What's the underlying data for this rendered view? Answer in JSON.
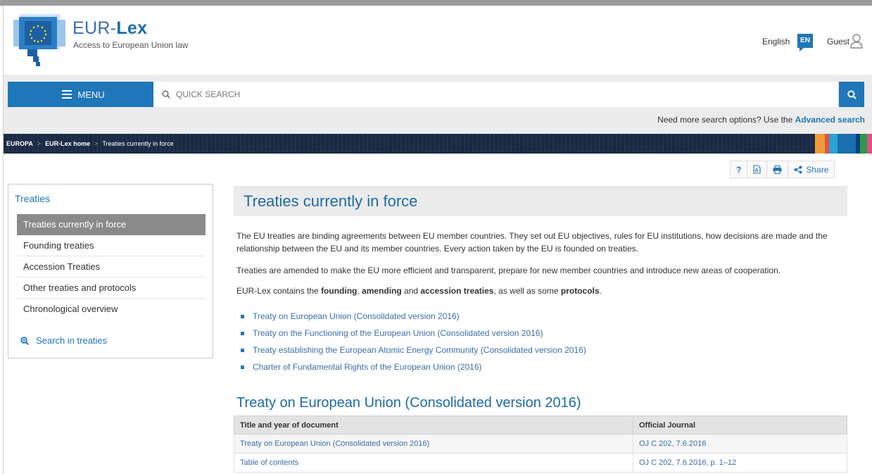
{
  "header": {
    "brand_prefix": "EUR-",
    "brand_bold": "Lex",
    "subtitle": "Access to European Union law",
    "language": "English",
    "language_code": "EN",
    "user": "Guest"
  },
  "search": {
    "menu_label": "MENU",
    "placeholder": "QUICK SEARCH",
    "advanced_prefix": "Need more search options? Use the",
    "advanced_link": "Advanced search"
  },
  "breadcrumb": {
    "items": [
      "EUROPA",
      "EUR-Lex home",
      "Treaties currently in force"
    ]
  },
  "tools": {
    "help": "?",
    "share": "Share"
  },
  "sidebar": {
    "title": "Treaties",
    "items": [
      {
        "label": "Treaties currently in force"
      },
      {
        "label": "Founding treaties"
      },
      {
        "label": "Accession Treaties"
      },
      {
        "label": "Other treaties and protocols"
      },
      {
        "label": "Chronological overview"
      }
    ],
    "search_label": "Search in treaties"
  },
  "main": {
    "title": "Treaties currently in force",
    "para1": "The EU treaties are binding agreements between EU member countries. They set out EU objectives, rules for EU institutions, how decisions are made and the relationship between the EU and its member countries. Every action taken by the EU is founded on treaties.",
    "para2": "Treaties are amended to make the EU more efficient and transparent, prepare for new member countries and introduce new areas of cooperation.",
    "para3": {
      "t1": "EUR-Lex contains the ",
      "b1": "founding",
      "t2": ", ",
      "b2": "amending",
      "t3": " and ",
      "b3": "accession treaties",
      "t4": ", as well as some ",
      "b4": "protocols",
      "t5": "."
    },
    "links": [
      "Treaty on European Union (Consolidated version 2016)",
      "Treaty on the Functioning of the European Union (Consolidated version 2016)",
      "Treaty establishing the European Atomic Energy Community (Consolidated version 2016)",
      "Charter of Fundamental Rights of the European Union (2016)"
    ],
    "section_title": "Treaty on European Union (Consolidated version 2016)",
    "table": {
      "headers": [
        "Title and year of document",
        "Official Journal"
      ],
      "rows": [
        [
          "Treaty on European Union (Consolidated version 2016)",
          "OJ C 202, 7.6.2016"
        ],
        [
          "Table of contents",
          "OJ C 202, 7.6.2016, p. 1–12"
        ]
      ]
    }
  },
  "colors": {
    "accent": "#1f76b9",
    "breadcrumb_bg": "#1a2a44",
    "band": [
      "#f29b38",
      "#e0553c",
      "#27a3d6",
      "#1a6fae",
      "#2a9a4a",
      "#e04d8a"
    ]
  }
}
